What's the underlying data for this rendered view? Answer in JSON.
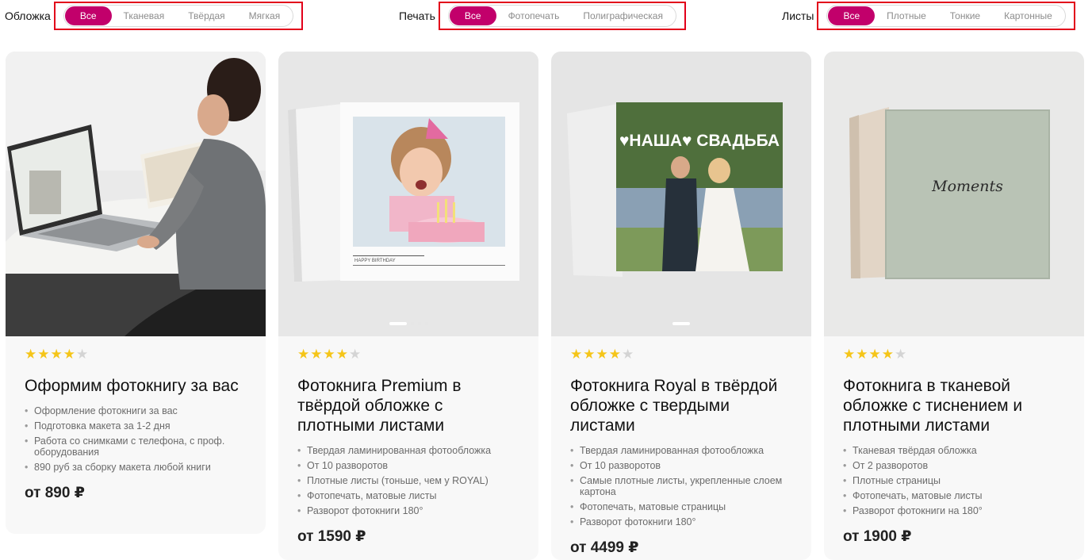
{
  "filters": {
    "cover": {
      "label": "Обложка",
      "options": [
        "Все",
        "Тканевая",
        "Твёрдая",
        "Мягкая"
      ],
      "selected": "Все"
    },
    "print": {
      "label": "Печать",
      "options": [
        "Все",
        "Фотопечать",
        "Полиграфическая"
      ],
      "selected": "Все"
    },
    "sheets": {
      "label": "Листы",
      "options": [
        "Все",
        "Плотные",
        "Тонкие",
        "Картонные"
      ],
      "selected": "Все"
    }
  },
  "colors": {
    "accent": "#c2006b",
    "highlight_box": "#e2001a",
    "star": "#f5c518"
  },
  "cards": [
    {
      "rating": 4,
      "title": "Оформим фотокнигу за вас",
      "features": [
        "Оформление фотокниги за вас",
        "Подготовка макета за 1-2 дня",
        "Работа со снимками с телефона, с проф. оборудования",
        "890 руб за сборку макета любой книги"
      ],
      "price": "от 890 ₽"
    },
    {
      "rating": 4,
      "title": "Фотокнига Premium в твёрдой обложке с плотными листами",
      "image_caption": "HAPPY BIRTHDAY",
      "features": [
        "Твердая ламинированная фотообложка",
        "От 10 разворотов",
        "Плотные листы (тоньше, чем у ROYAL)",
        "Фотопечать, матовые листы",
        "Разворот фотокниги 180°"
      ],
      "price": "от 1590 ₽"
    },
    {
      "rating": 4,
      "title": "Фотокнига Royal в твёрдой обложке с твердыми листами",
      "image_caption": "♥НАША♥ СВАДЬБА",
      "features": [
        "Твердая ламинированная фотообложка",
        "От 10 разворотов",
        "Самые плотные листы, укрепленные слоем картона",
        "Фотопечать, матовые страницы",
        "Разворот фотокниги 180°"
      ],
      "price": "от 4499 ₽"
    },
    {
      "rating": 4,
      "title": "Фотокнига в тканевой обложке с тиснением и плотными листами",
      "image_caption": "Moments",
      "features": [
        "Тканевая твёрдая обложка",
        "От 2 разворотов",
        "Плотные страницы",
        "Фотопечать, матовые листы",
        "Разворот фотокниги на 180°"
      ],
      "price": "от 1900 ₽"
    }
  ]
}
